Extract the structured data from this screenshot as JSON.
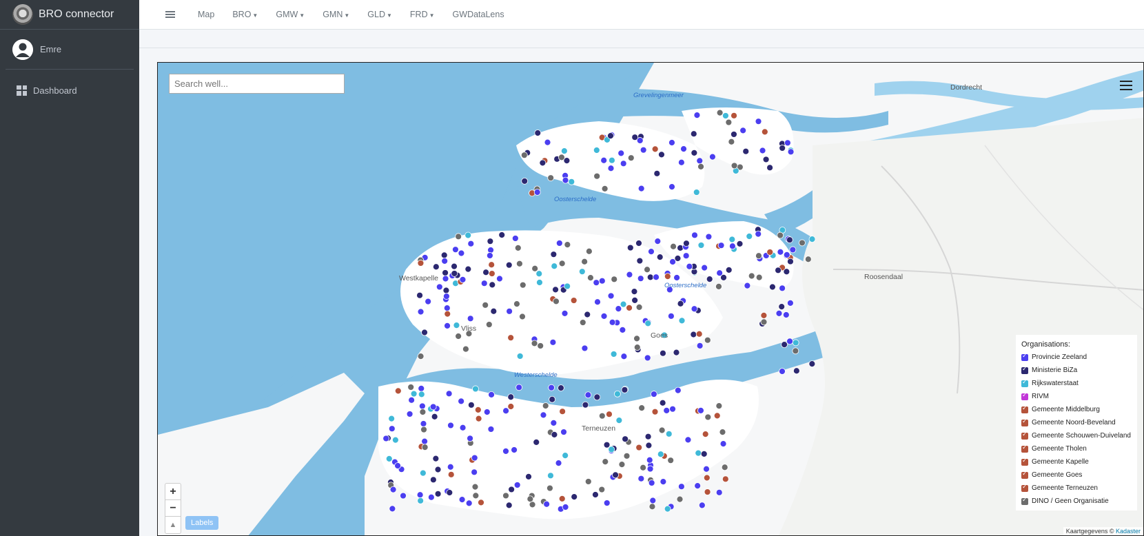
{
  "app": {
    "brand": "BRO connector",
    "user": "Emre"
  },
  "sidebar": {
    "items": [
      {
        "label": "Dashboard",
        "icon": "dashboard-grid-icon"
      }
    ]
  },
  "topnav": {
    "items": [
      {
        "label": "Map",
        "dropdown": false
      },
      {
        "label": "BRO",
        "dropdown": true
      },
      {
        "label": "GMW",
        "dropdown": true
      },
      {
        "label": "GMN",
        "dropdown": true
      },
      {
        "label": "GLD",
        "dropdown": true
      },
      {
        "label": "FRD",
        "dropdown": true
      },
      {
        "label": "GWDataLens",
        "dropdown": false
      }
    ]
  },
  "map": {
    "search_placeholder": "Search well...",
    "labels_button": "Labels",
    "zoom_in": "+",
    "zoom_out": "−",
    "reset_north": "▲",
    "attribution_prefix": "Kaartgegevens © ",
    "attribution_link": "Kadaster",
    "place_labels": {
      "grevelingenmeer": "Grevelingenmeer",
      "oosterschelde": "Oosterschelde",
      "westerschelde": "Westerschelde",
      "oosterschelde_east": "Oosterschelde",
      "dordrecht": "Dordrecht",
      "roosendaal": "Roosendaal",
      "westkapelle": "Westkapelle",
      "vlissingen": "Vliss",
      "goes": "Goes",
      "terneuzen": "Terneuzen"
    },
    "legend": {
      "title": "Organisations:",
      "items": [
        {
          "label": "Provincie Zeeland",
          "color": "#4b3ef0",
          "checked": true
        },
        {
          "label": "Ministerie BiZa",
          "color": "#2c2870",
          "checked": true
        },
        {
          "label": "Rijkswaterstaat",
          "color": "#3fb9d8",
          "checked": true
        },
        {
          "label": "RIVM",
          "color": "#c236d8",
          "checked": true
        },
        {
          "label": "Gemeente Middelburg",
          "color": "#b5533a",
          "checked": true
        },
        {
          "label": "Gemeente Noord-Beveland",
          "color": "#b5533a",
          "checked": true
        },
        {
          "label": "Gemeente Schouwen-Duiveland",
          "color": "#b5533a",
          "checked": true
        },
        {
          "label": "Gemeente Tholen",
          "color": "#b5533a",
          "checked": true
        },
        {
          "label": "Gemeente Kapelle",
          "color": "#b5533a",
          "checked": true
        },
        {
          "label": "Gemeente Goes",
          "color": "#b5533a",
          "checked": true
        },
        {
          "label": "Gemeente Terneuzen",
          "color": "#b5533a",
          "checked": true
        },
        {
          "label": "DINO / Geen Organisatie",
          "color": "#6c6c6c",
          "checked": true
        }
      ]
    }
  }
}
